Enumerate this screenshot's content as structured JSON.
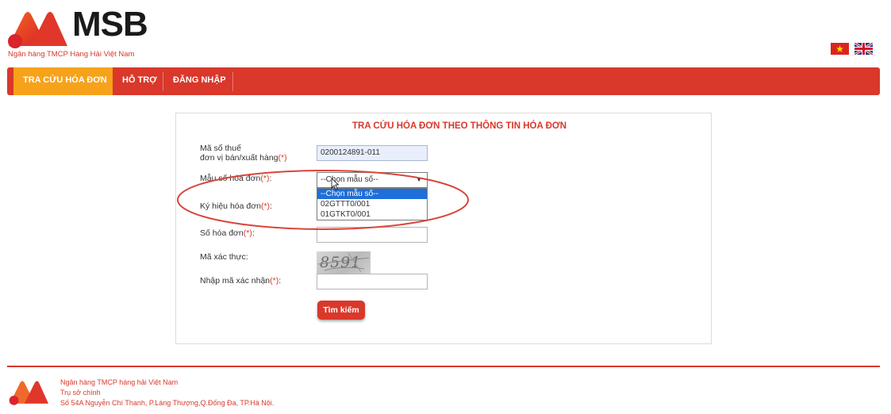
{
  "header": {
    "brand": "MSB",
    "subtitle": "Ngân hàng TMCP Hàng Hải Việt Nam",
    "languages": [
      "vietnamese-flag",
      "english-flag"
    ]
  },
  "nav": {
    "items": [
      {
        "label": "TRA CỨU HÓA ĐƠN",
        "active": true
      },
      {
        "label": "HỖ TRỢ",
        "active": false
      },
      {
        "label": "ĐĂNG NHẬP",
        "active": false
      }
    ]
  },
  "form": {
    "title": "TRA CỨU HÓA ĐƠN THEO THÔNG TIN HÓA ĐƠN",
    "required_mark": "(*)",
    "tax_code": {
      "label_line1": "Mã số thuế",
      "label_line2": "đơn vị bán/xuất hàng",
      "value": "0200124891-011"
    },
    "template": {
      "label": "Mẫu số hóa đơn",
      "selected": "--Chọn mẫu số--",
      "options": [
        "--Chọn mẫu số--",
        "02GTTT0/001",
        "01GTKT0/001"
      ]
    },
    "symbol": {
      "label": "Ký hiệu hóa đơn",
      "value": ""
    },
    "invoice_no": {
      "label": "Số hóa đơn",
      "value": ""
    },
    "captcha": {
      "label": "Mã xác thực:",
      "image_text": "8591"
    },
    "captcha_input": {
      "label": "Nhập mã xác nhận",
      "value": ""
    },
    "submit_label": "Tìm kiếm"
  },
  "footer": {
    "line1": "Ngân hàng TMCP hàng hải Việt Nam",
    "line2": "Trụ sở chính",
    "line3": "Số 54A Nguyễn Chí Thanh, P.Láng Thượng,Q.Đống Đa, TP.Hà Nội."
  },
  "colors": {
    "brand_red": "#d9382b",
    "active_tab": "#f7a21b",
    "selected_option": "#1e6fd9"
  }
}
